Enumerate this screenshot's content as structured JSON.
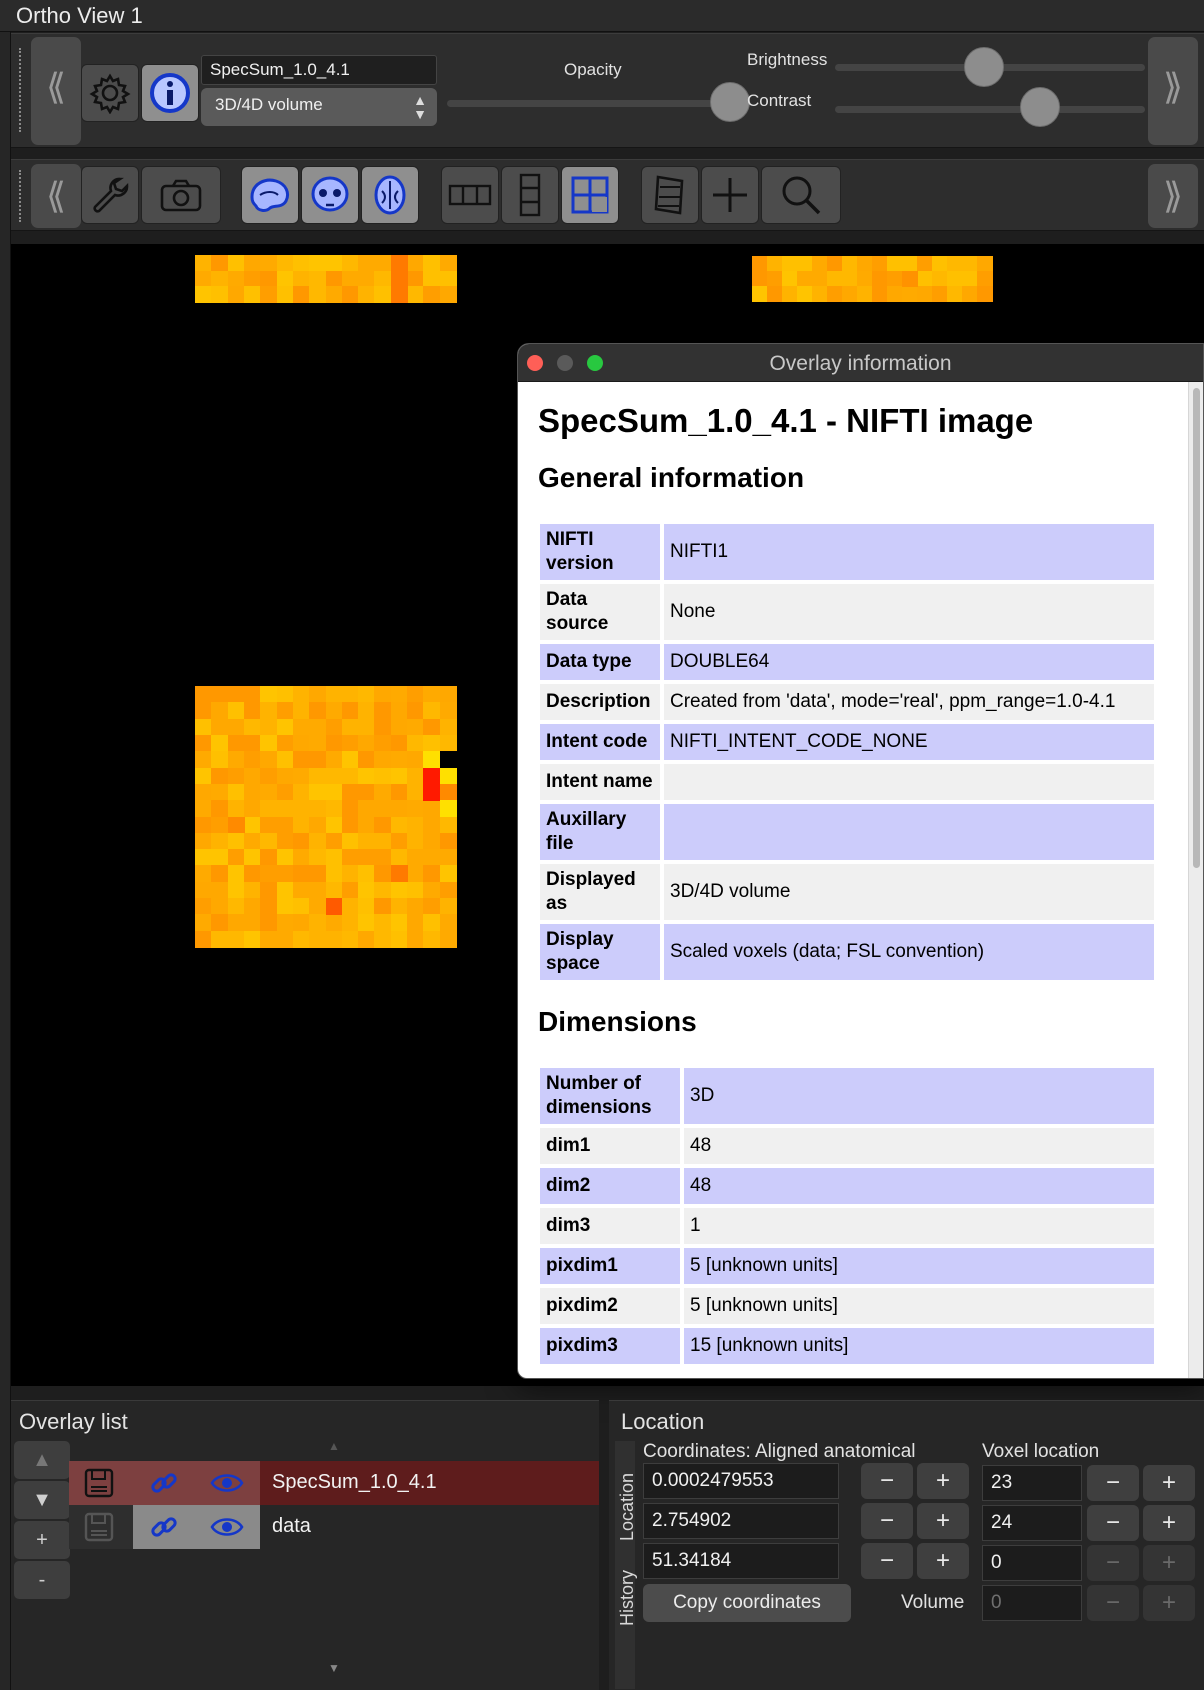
{
  "window": {
    "title": "Ortho View 1"
  },
  "toolbar1": {
    "overlay_name": "SpecSum_1.0_4.1",
    "display_type": "3D/4D volume",
    "opacity_label": "Opacity",
    "brightness_label": "Brightness",
    "contrast_label": "Contrast",
    "opacity_level": 0.97,
    "brightness_level": 0.48,
    "contrast_level": 0.66,
    "prev_label": "⟪",
    "next_label": "⟫"
  },
  "toolbar2": {
    "prev_label": "⟪",
    "next_label": "⟫",
    "icons": [
      "wrench-icon",
      "camera-icon",
      "sagittal-brain-icon",
      "coronal-brain-icon",
      "axial-brain-icon",
      "horizontal-layout-icon",
      "vertical-layout-icon",
      "grid-layout-icon",
      "movie-icon",
      "crosshair-icon",
      "zoom-icon"
    ]
  },
  "info_window": {
    "title": "Overlay information",
    "heading": "SpecSum_1.0_4.1 - NIFTI image",
    "general_title": "General information",
    "general": [
      {
        "key": "NIFTI version",
        "value": "NIFTI1"
      },
      {
        "key": "Data source",
        "value": "None"
      },
      {
        "key": "Data type",
        "value": "DOUBLE64"
      },
      {
        "key": "Description",
        "value": "Created from 'data', mode='real', ppm_range=1.0-4.1"
      },
      {
        "key": "Intent code",
        "value": "NIFTI_INTENT_CODE_NONE"
      },
      {
        "key": "Intent name",
        "value": ""
      },
      {
        "key": "Auxillary file",
        "value": ""
      },
      {
        "key": "Displayed as",
        "value": "3D/4D volume"
      },
      {
        "key": "Display space",
        "value": "Scaled voxels (data; FSL convention)"
      }
    ],
    "dimensions_title": "Dimensions",
    "dimensions": [
      {
        "key": "Number of dimensions",
        "value": "3D"
      },
      {
        "key": "dim1",
        "value": "48"
      },
      {
        "key": "dim2",
        "value": "48"
      },
      {
        "key": "dim3",
        "value": "1"
      },
      {
        "key": "pixdim1",
        "value": "5 [unknown units]"
      },
      {
        "key": "pixdim2",
        "value": "5 [unknown units]"
      },
      {
        "key": "pixdim3",
        "value": "15 [unknown units]"
      }
    ]
  },
  "overlay_list": {
    "title": "Overlay list",
    "up_label": "▲",
    "down_label": "▼",
    "add_label": "+",
    "remove_label": "-",
    "items": [
      {
        "name": "SpecSum_1.0_4.1",
        "selected": true
      },
      {
        "name": "data",
        "selected": false
      }
    ]
  },
  "location": {
    "title": "Location",
    "coords_label": "Coordinates: Aligned anatomical",
    "voxel_label": "Voxel location",
    "coords": [
      "0.0002479553",
      "2.754902",
      "51.34184"
    ],
    "voxels": [
      "23",
      "24",
      "0"
    ],
    "copy_label": "Copy coordinates",
    "volume_label": "Volume",
    "volume_value": "0",
    "tab_location": "Location",
    "tab_history": "History",
    "minus": "−",
    "plus": "+"
  },
  "colors": {
    "accent_blue": "#2a46d8",
    "selected_row": "#6a1f1f",
    "heat_red": "#ff1a00",
    "heat_yellow": "#ffd800"
  }
}
